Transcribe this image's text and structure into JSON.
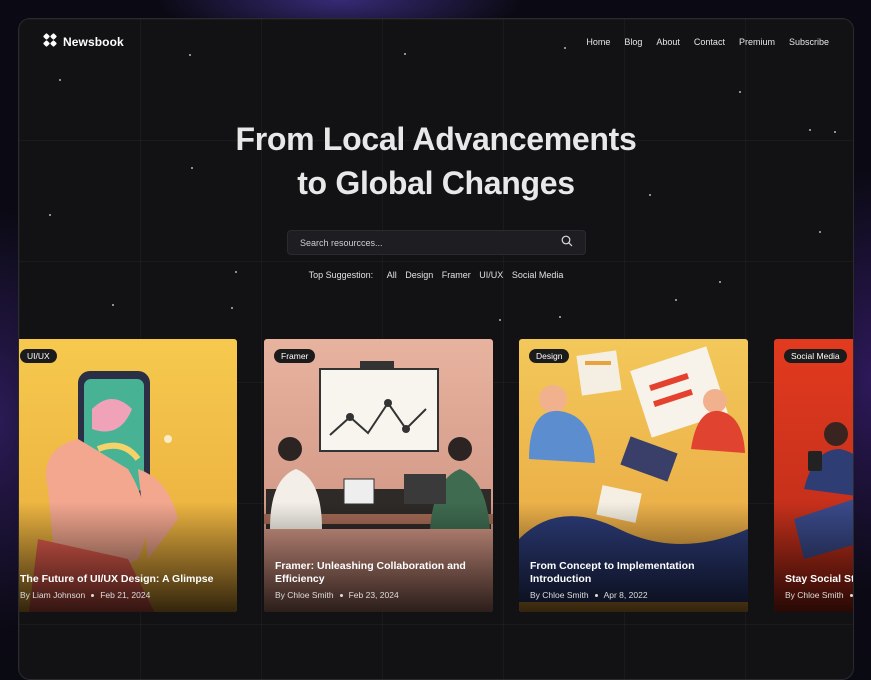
{
  "brand": {
    "name": "Newsbook"
  },
  "nav": {
    "items": [
      "Home",
      "Blog",
      "About",
      "Contact",
      "Premium",
      "Subscribe"
    ]
  },
  "hero": {
    "line1": "From Local Advancements",
    "line2": "to Global Changes"
  },
  "search": {
    "placeholder": "Search resourcces..."
  },
  "suggestions": {
    "label": "Top Suggestion:",
    "items": [
      "All",
      "Design",
      "Framer",
      "UI/UX",
      "Social Media"
    ]
  },
  "cards": [
    {
      "tag": "UI/UX",
      "title": "The Future of UI/UX Design: A Glimpse",
      "author": "By Liam Johnson",
      "date": "Feb 21, 2024"
    },
    {
      "tag": "Framer",
      "title": "Framer: Unleashing Collaboration and Efficiency",
      "author": "By Chloe Smith",
      "date": "Feb 23, 2024"
    },
    {
      "tag": "Design",
      "title": "From Concept to Implementation Introduction",
      "author": "By Chloe Smith",
      "date": "Apr 8, 2022"
    },
    {
      "tag": "Social Media",
      "title": "Stay Social Stories: Demystifying",
      "author": "By Chloe Smith",
      "date": ""
    }
  ],
  "colors": {
    "background": "#121214",
    "accent_yellow": "#f2c14e",
    "accent_red": "#d9331f"
  }
}
